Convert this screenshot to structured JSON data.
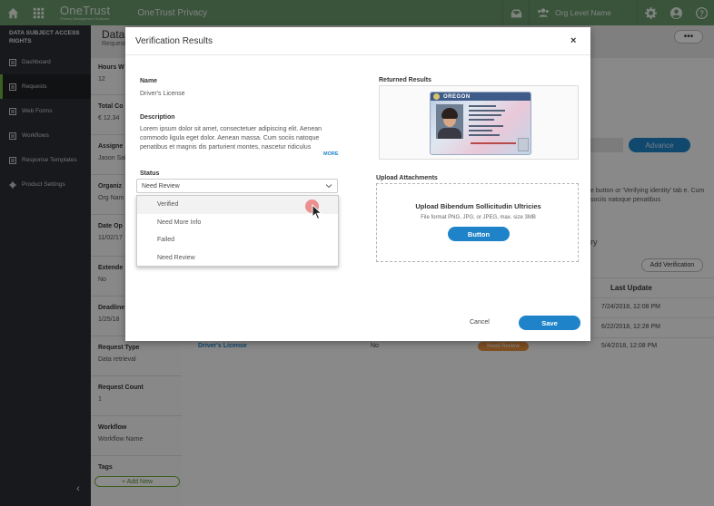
{
  "topbar": {
    "logo": "OneTrust",
    "logo_sub": "Privacy Management Software",
    "app_title": "OneTrust Privacy",
    "org_label": "Org Level Name"
  },
  "sidebar": {
    "title": "DATA SUBJECT ACCESS RIGHTS",
    "items": [
      {
        "label": "Dashboard",
        "icon": "dashboard-icon"
      },
      {
        "label": "Requests",
        "icon": "requests-icon",
        "active": true
      },
      {
        "label": "Web Forms",
        "icon": "web-forms-icon"
      },
      {
        "label": "Workflows",
        "icon": "workflows-icon"
      },
      {
        "label": "Response Templates",
        "icon": "templates-icon"
      },
      {
        "label": "Product Settings",
        "icon": "gear-icon"
      }
    ],
    "collapse_glyph": "‹"
  },
  "background": {
    "title": "Data",
    "subtitle": "Request",
    "kebab": "•••",
    "fields": [
      {
        "label": "Hours W",
        "value": "12"
      },
      {
        "label": "Total Co",
        "value": "€ 12.34"
      },
      {
        "label": "Assigne",
        "value": "Jason Sal"
      },
      {
        "label": "Organiz",
        "value": "Org Nam"
      },
      {
        "label": "Date Op",
        "value": "11/02/17"
      },
      {
        "label": "Extende",
        "value": "No"
      },
      {
        "label": "Deadline",
        "value": "1/25/18"
      },
      {
        "label": "Request Type",
        "value": "Data retrieval"
      },
      {
        "label": "Request Count",
        "value": "1"
      },
      {
        "label": "Workflow",
        "value": "Workflow Name"
      },
      {
        "label": "Tags",
        "value": ""
      }
    ],
    "add_new": "+ Add New",
    "advance_label": "Advance",
    "help_text": "e button or 'Verifying identity' tab e. Cum sociis natoque penatibus",
    "section_suffix": "ry",
    "add_verification": "Add Verification",
    "last_update_header": "Last Update",
    "last_updates": [
      "7/24/2018, 12:08 PM",
      "6/22/2018, 12:28 PM",
      "5/4/2018, 12:08 PM"
    ],
    "row": {
      "link": "Driver's License",
      "extended": "No",
      "status": "Need Review"
    }
  },
  "modal": {
    "title": "Verification Results",
    "close_glyph": "×",
    "name_label": "Name",
    "name_value": "Driver's License",
    "description_label": "Description",
    "description_value": "Lorem ipsum dolor sit amet, consectetuer adipiscing elit. Aenean commodo ligula eget dolor. Aenean massa. Cum sociis natoque penatibus et magnis dis parturient montes, nascetur ridiculus",
    "more_link": "MORE",
    "status_label": "Status",
    "status_value": "Need Review",
    "status_options": [
      "Verified",
      "Need More Info",
      "Failed",
      "Need Review"
    ],
    "hovered_option_index": 0,
    "returned_results_label": "Returned Results",
    "license_state": "OREGON",
    "upload_label": "Upload Attachments",
    "upload_title": "Upload Bibendum Sollicitudin Ultricies",
    "upload_hint": "File format PNG, JPG, or JPEG, max. size 3MB",
    "upload_button": "Button",
    "cancel_label": "Cancel",
    "save_label": "Save"
  },
  "colors": {
    "topbar": "#6b9a6d",
    "sidebar": "#2b2f33",
    "accent_green": "#6fae3f",
    "primary_blue": "#1f83c9",
    "badge_orange": "#e8913d"
  }
}
